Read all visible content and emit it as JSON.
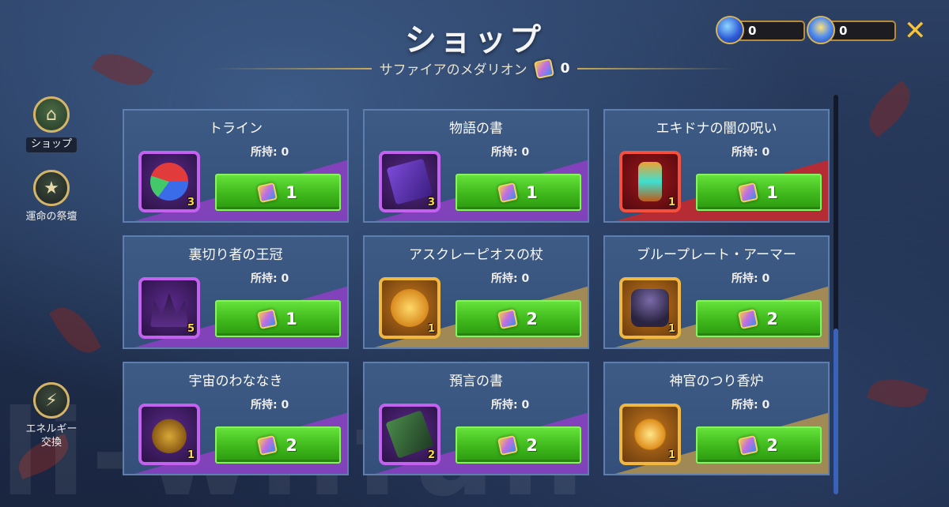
{
  "header": {
    "title": "ショップ",
    "subtitle": "サファイアのメダリオン",
    "sub_count": "0"
  },
  "currencies": [
    {
      "icon": "blue-gem-icon",
      "value": "0"
    },
    {
      "icon": "medal-coin-icon",
      "value": "0"
    }
  ],
  "sidebar": {
    "items": [
      {
        "label": "ショップ",
        "icon": "shop-icon",
        "active": true
      },
      {
        "label": "運命の祭壇",
        "icon": "star-icon",
        "active": false
      },
      {
        "label": "エネルギー\n交換",
        "icon": "energy-icon",
        "active": false
      }
    ]
  },
  "owned_label": "所持:",
  "shop": {
    "items": [
      {
        "name": "トライン",
        "owned": "所持: 0",
        "qty": "3",
        "price": "1",
        "frame": "purple"
      },
      {
        "name": "物語の書",
        "owned": "所持: 0",
        "qty": "3",
        "price": "1",
        "frame": "purple"
      },
      {
        "name": "エキドナの闇の呪い",
        "owned": "所持: 0",
        "qty": "1",
        "price": "1",
        "frame": "red"
      },
      {
        "name": "裏切り者の王冠",
        "owned": "所持: 0",
        "qty": "5",
        "price": "1",
        "frame": "purple"
      },
      {
        "name": "アスクレーピオスの杖",
        "owned": "所持: 0",
        "qty": "1",
        "price": "2",
        "frame": "gold"
      },
      {
        "name": "ブループレート・アーマー",
        "owned": "所持: 0",
        "qty": "1",
        "price": "2",
        "frame": "gold"
      },
      {
        "name": "宇宙のわななき",
        "owned": "所持: 0",
        "qty": "1",
        "price": "2",
        "frame": "purple"
      },
      {
        "name": "預言の書",
        "owned": "所持: 0",
        "qty": "2",
        "price": "2",
        "frame": "purple"
      },
      {
        "name": "神官のつり香炉",
        "owned": "所持: 0",
        "qty": "1",
        "price": "2",
        "frame": "gold"
      }
    ]
  },
  "colors": {
    "buy_button": "#3fb81c",
    "purple_rarity": "#c462f0",
    "gold_rarity": "#f0b840",
    "red_rarity": "#f5503e",
    "accent_gold": "#d8b456"
  },
  "watermark": "li-wi.fun"
}
